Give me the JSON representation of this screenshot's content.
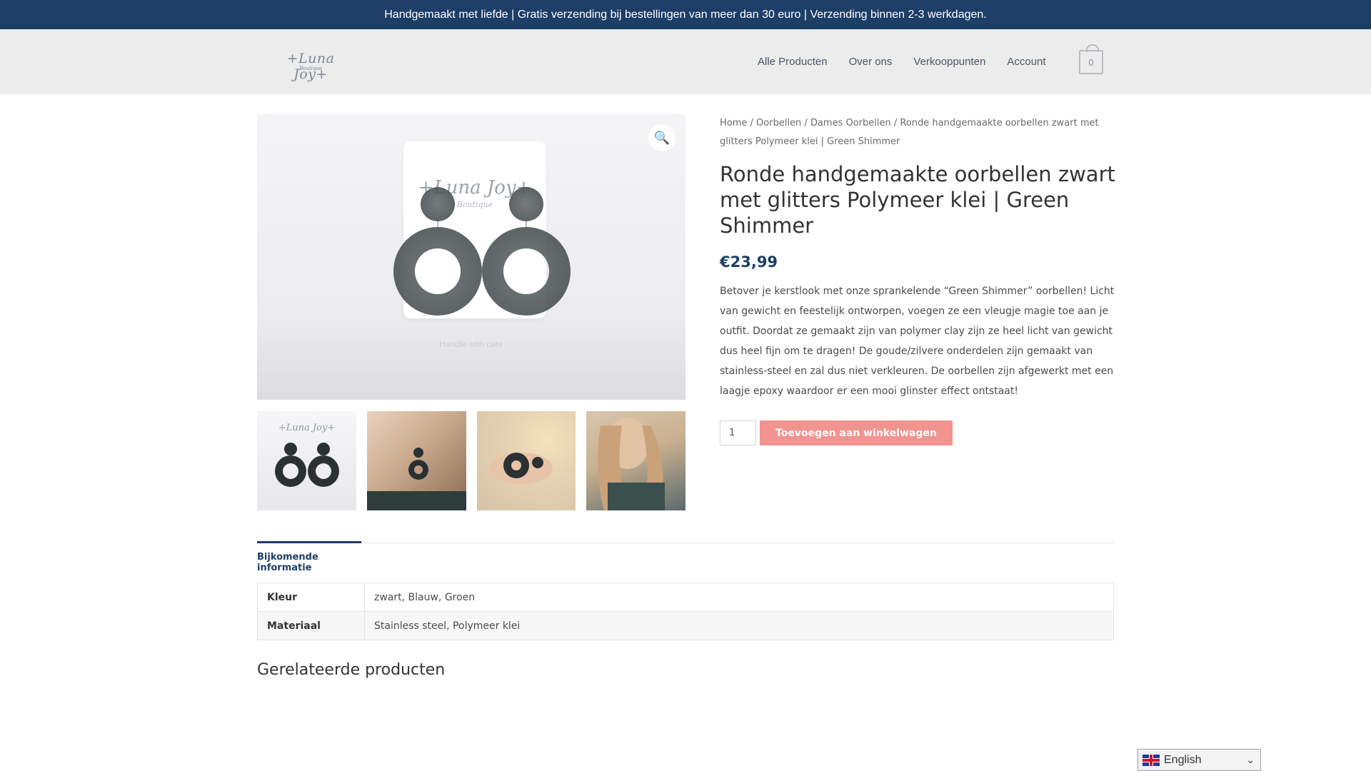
{
  "announcement": "Handgemaakt met liefde | Gratis verzending bij bestellingen van meer dan 30 euro | Verzending binnen 2-3 werkdagen.",
  "logo": {
    "main": "+Luna Joy+",
    "sub": "Boutique"
  },
  "nav": {
    "items": [
      "Alle Producten",
      "Over ons",
      "Verkooppunten",
      "Account"
    ],
    "cart_count": "0"
  },
  "gallery": {
    "card_logo": "+Luna Joy+",
    "card_sub": "Boutique",
    "card_care": "Handle with care",
    "zoom_icon": "magnifier-icon",
    "thumb_logo": "+Luna Joy+"
  },
  "breadcrumb": {
    "home": "Home",
    "cat1": "Oorbellen",
    "cat2": "Dames Oorbellen",
    "current": "Ronde handgemaakte oorbellen zwart met glitters Polymeer klei | Green Shimmer",
    "sep": " / "
  },
  "product": {
    "title": "Ronde handgemaakte oorbellen zwart met glitters Polymeer klei | Green Shimmer",
    "price": "€23,99",
    "description": "Betover je kerstlook met onze sprankelende “Green Shimmer” oorbellen! Licht van gewicht en feestelijk ontworpen, voegen ze een vleugje magie toe aan je outfit. Doordat ze gemaakt zijn van polymer clay zijn ze heel licht van gewicht dus heel fijn om te dragen! De goude/zilvere onderdelen zijn gemaakt van stainless-steel en zal dus niet verkleuren. De oorbellen zijn afgewerkt met een laagje epoxy waardoor er een mooi glinster effect ontstaat!",
    "quantity": "1",
    "add_to_cart": "Toevoegen aan winkelwagen"
  },
  "tabs": {
    "info": "Bijkomende informatie"
  },
  "attributes": [
    {
      "label": "Kleur",
      "value": "zwart, Blauw, Groen"
    },
    {
      "label": "Materiaal",
      "value": "Stainless steel, Polymeer klei"
    }
  ],
  "related_title": "Gerelateerde producten",
  "language": {
    "label": "English",
    "flag": "uk-flag-icon"
  },
  "colors": {
    "primary": "#1d3e66",
    "button": "#f1938f"
  }
}
